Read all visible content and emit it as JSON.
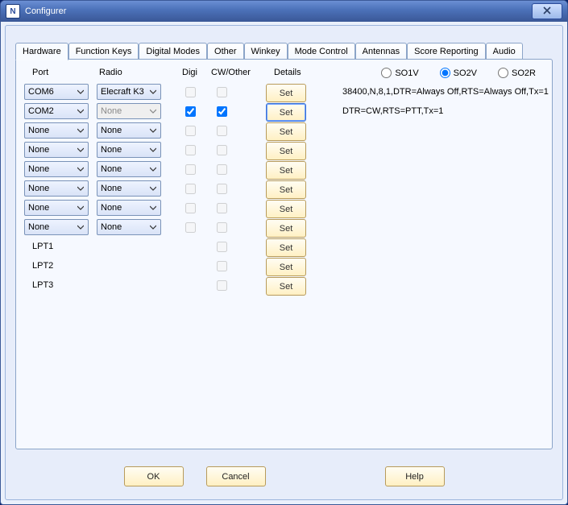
{
  "window": {
    "title": "Configurer"
  },
  "tabs": [
    "Hardware",
    "Function Keys",
    "Digital Modes",
    "Other",
    "Winkey",
    "Mode Control",
    "Antennas",
    "Score Reporting",
    "Audio"
  ],
  "headers": {
    "port": "Port",
    "radio": "Radio",
    "digi": "Digi",
    "cwother": "CW/Other",
    "details": "Details"
  },
  "so": {
    "labels": [
      "SO1V",
      "SO2V",
      "SO2R"
    ],
    "selected": "SO2V"
  },
  "rows": [
    {
      "port": "COM6",
      "radio": "Elecraft K3",
      "digi": false,
      "cw": false,
      "details": "38400,N,8,1,DTR=Always Off,RTS=Always Off,Tx=1"
    },
    {
      "port": "COM2",
      "radio": "None",
      "radio_disabled": true,
      "digi": true,
      "cw": true,
      "details": "DTR=CW,RTS=PTT,Tx=1"
    },
    {
      "port": "None",
      "radio": "None",
      "digi": false,
      "cw": false,
      "details": ""
    },
    {
      "port": "None",
      "radio": "None",
      "digi": false,
      "cw": false,
      "details": ""
    },
    {
      "port": "None",
      "radio": "None",
      "digi": false,
      "cw": false,
      "details": ""
    },
    {
      "port": "None",
      "radio": "None",
      "digi": false,
      "cw": false,
      "details": ""
    },
    {
      "port": "None",
      "radio": "None",
      "digi": false,
      "cw": false,
      "details": ""
    },
    {
      "port": "None",
      "radio": "None",
      "digi": false,
      "cw": false,
      "details": ""
    }
  ],
  "lpt": [
    "LPT1",
    "LPT2",
    "LPT3"
  ],
  "buttons": {
    "set": "Set",
    "ok": "OK",
    "cancel": "Cancel",
    "help": "Help"
  }
}
